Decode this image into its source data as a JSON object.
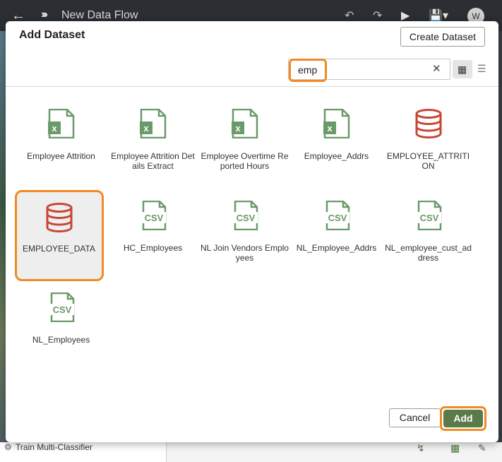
{
  "app": {
    "title": "New Data Flow",
    "user_initial": "W",
    "bottom_step_label": "Train Multi-Classifier"
  },
  "dialog": {
    "title": "Add Dataset",
    "create_label": "Create Dataset",
    "search": {
      "value": "emp",
      "placeholder": ""
    },
    "cancel_label": "Cancel",
    "add_label": "Add"
  },
  "datasets": [
    {
      "name": "Employee Attrition",
      "type": "excel"
    },
    {
      "name": "Employee Attrition Details Extract",
      "type": "excel"
    },
    {
      "name": "Employee Overtime Reported Hours",
      "type": "excel"
    },
    {
      "name": "Employee_Addrs",
      "type": "excel"
    },
    {
      "name": "EMPLOYEE_ATTRITION",
      "type": "database"
    },
    {
      "name": "EMPLOYEE_DATA",
      "type": "database",
      "selected": true
    },
    {
      "name": "HC_Employees",
      "type": "csv"
    },
    {
      "name": "NL Join Vendors Employees",
      "type": "csv"
    },
    {
      "name": "NL_Employee_Addrs",
      "type": "csv"
    },
    {
      "name": "NL_employee_cust_address",
      "type": "csv"
    },
    {
      "name": "NL_Employees",
      "type": "csv"
    }
  ],
  "colors": {
    "excel": "#6a9a6a",
    "csv": "#6a9a6a",
    "database": "#c74634",
    "highlight": "#f08a24",
    "primary_button": "#5b7a4a"
  },
  "icons": {
    "back": "arrow-left-icon",
    "flow": "data-flow-icon",
    "undo": "undo-icon",
    "redo": "redo-icon",
    "run": "play-icon",
    "save": "save-icon",
    "clear": "close-icon",
    "grid_view": "grid-view-icon",
    "list_view": "list-view-icon"
  }
}
